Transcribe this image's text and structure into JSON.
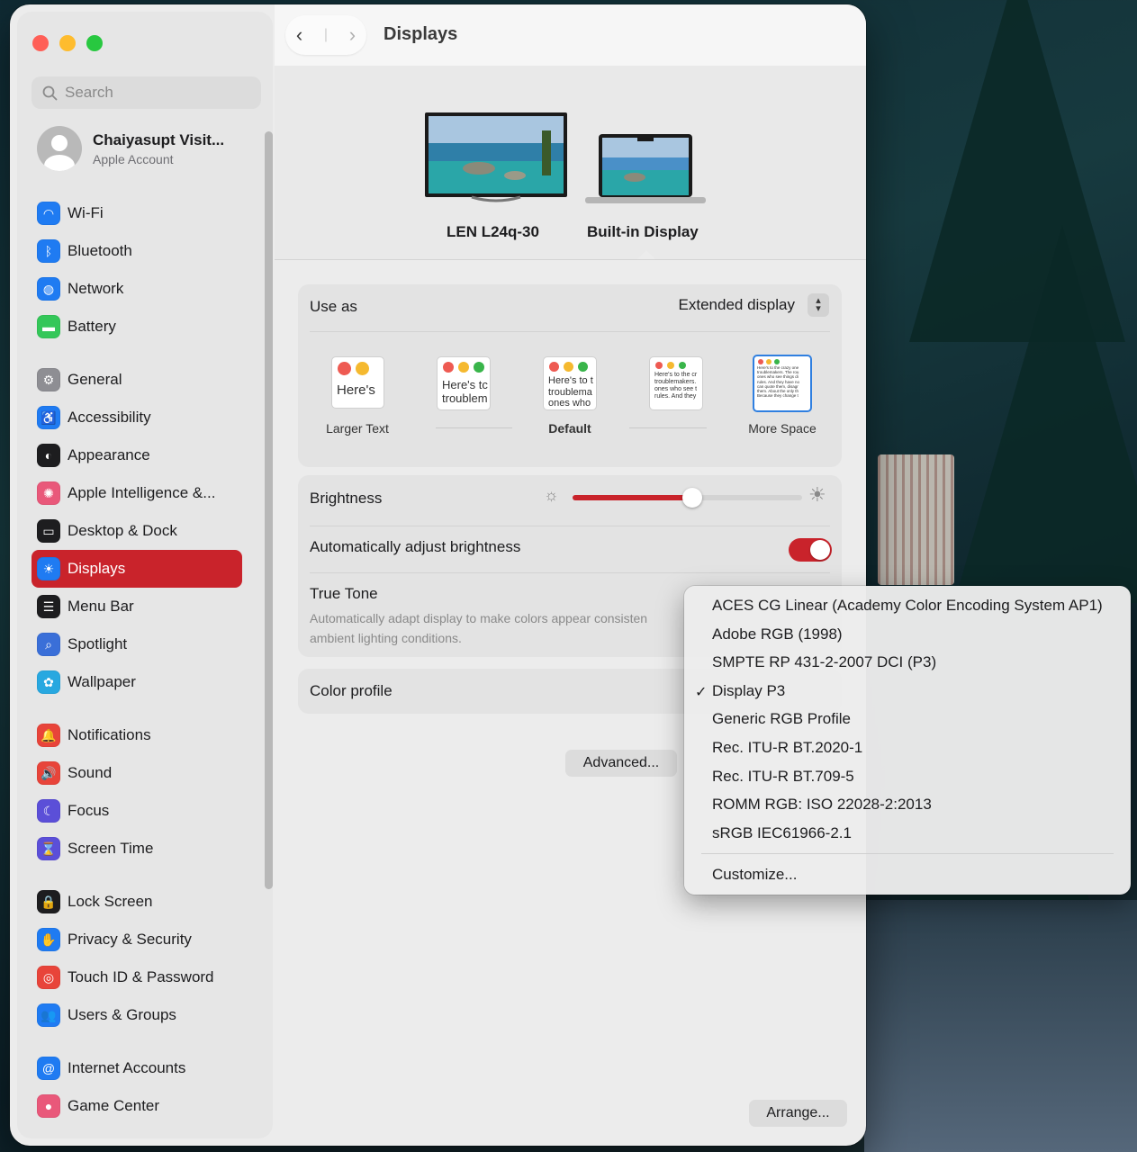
{
  "window": {
    "title": "Displays"
  },
  "search": {
    "placeholder": "Search"
  },
  "account": {
    "name": "Chaiyasupt Visit...",
    "subtitle": "Apple Account"
  },
  "sidebar": {
    "items": [
      {
        "label": "Wi-Fi",
        "icon": "wifi-icon",
        "color": "#1f7bf2"
      },
      {
        "label": "Bluetooth",
        "icon": "bluetooth-icon",
        "color": "#1f7bf2"
      },
      {
        "label": "Network",
        "icon": "globe-icon",
        "color": "#1f7bf2"
      },
      {
        "label": "Battery",
        "icon": "battery-icon",
        "color": "#34c759"
      },
      {
        "label": "General",
        "icon": "gear-icon",
        "color": "#8e8e93"
      },
      {
        "label": "Accessibility",
        "icon": "accessibility-icon",
        "color": "#1f7bf2"
      },
      {
        "label": "Appearance",
        "icon": "appearance-icon",
        "color": "#1d1d1f"
      },
      {
        "label": "Apple Intelligence &...",
        "icon": "apple-intelligence-icon",
        "color": "#e9587a"
      },
      {
        "label": "Desktop & Dock",
        "icon": "dock-icon",
        "color": "#1d1d1f"
      },
      {
        "label": "Displays",
        "icon": "sun-icon",
        "color": "#1f7bf2"
      },
      {
        "label": "Menu Bar",
        "icon": "menubar-icon",
        "color": "#1d1d1f"
      },
      {
        "label": "Spotlight",
        "icon": "magnifier-icon",
        "color": "#3a6fd8"
      },
      {
        "label": "Wallpaper",
        "icon": "flower-icon",
        "color": "#28a8e0"
      },
      {
        "label": "Notifications",
        "icon": "bell-icon",
        "color": "#e8443a"
      },
      {
        "label": "Sound",
        "icon": "speaker-icon",
        "color": "#e8443a"
      },
      {
        "label": "Focus",
        "icon": "moon-icon",
        "color": "#5b4fd8"
      },
      {
        "label": "Screen Time",
        "icon": "hourglass-icon",
        "color": "#5b4fd8"
      },
      {
        "label": "Lock Screen",
        "icon": "lock-icon",
        "color": "#1d1d1f"
      },
      {
        "label": "Privacy & Security",
        "icon": "hand-icon",
        "color": "#1f7bf2"
      },
      {
        "label": "Touch ID & Password",
        "icon": "fingerprint-icon",
        "color": "#e8443a"
      },
      {
        "label": "Users & Groups",
        "icon": "users-icon",
        "color": "#1f7bf2"
      },
      {
        "label": "Internet Accounts",
        "icon": "at-icon",
        "color": "#1f7bf2"
      },
      {
        "label": "Game Center",
        "icon": "gamecenter-icon",
        "color": "#e9587a"
      }
    ],
    "active": "Displays"
  },
  "displays": [
    {
      "name": "LEN L24q-30"
    },
    {
      "name": "Built-in Display"
    }
  ],
  "use_as": {
    "label": "Use as",
    "value": "Extended display"
  },
  "resolution": {
    "larger_label": "Larger Text",
    "default_label": "Default",
    "more_label": "More Space",
    "thumb_text_1": "Here's",
    "thumb_text_2a": "Here's tc",
    "thumb_text_2b": "troublem",
    "thumb_text_3a": "Here's to t",
    "thumb_text_3b": "troublema",
    "thumb_text_3c": "ones who",
    "thumb_text_4a": "Here's to the cr",
    "thumb_text_4b": "troublemakers.",
    "thumb_text_4c": "ones who see t",
    "thumb_text_4d": "rules. And they",
    "thumb_text_5a": "Here's to the crazy one",
    "thumb_text_5b": "troublemakers. The rou",
    "thumb_text_5c": "ones who see things di",
    "thumb_text_5d": "rules. And they have no",
    "thumb_text_5e": "can quote them, disagr",
    "thumb_text_5f": "them. About the only th",
    "thumb_text_5g": "Because they change t"
  },
  "brightness": {
    "label": "Brightness",
    "level": 0.52
  },
  "auto_brightness": {
    "label": "Automatically adjust brightness",
    "on": true
  },
  "true_tone": {
    "label": "True Tone",
    "desc_line1": "Automatically adapt display to make colors appear consisten",
    "desc_line2": "ambient lighting conditions."
  },
  "color_profile": {
    "label": "Color profile"
  },
  "buttons": {
    "advanced": "Advanced...",
    "arrange": "Arrange..."
  },
  "dropdown": {
    "items": [
      "ACES CG Linear (Academy Color Encoding System AP1)",
      "Adobe RGB (1998)",
      "SMPTE RP 431-2-2007 DCI (P3)",
      "Display P3",
      "Generic RGB Profile",
      "Rec. ITU-R BT.2020-1",
      "Rec. ITU-R BT.709-5",
      "ROMM RGB: ISO 22028-2:2013",
      "sRGB IEC61966-2.1"
    ],
    "selected": "Display P3",
    "checkmark": "✓",
    "customize": "Customize..."
  },
  "colors": {
    "accent": "#c9232b"
  }
}
